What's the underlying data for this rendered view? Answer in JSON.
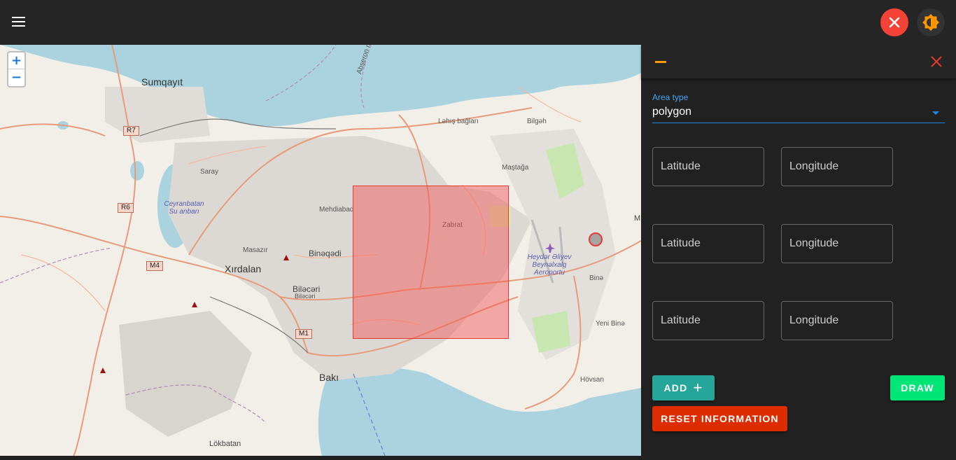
{
  "topbar": {
    "menu_icon": "hamburger-icon",
    "close_icon": "close-icon",
    "theme_icon": "brightness-icon"
  },
  "map": {
    "zoom_in": "+",
    "zoom_out": "−",
    "labels": {
      "sumqayit": "Sumqayıt",
      "abseron": "Abşeron rayonu",
      "lahic": "Ləhış bağları",
      "bilgah": "Bilgəh",
      "mastaga": "Maştağa",
      "saray": "Saray",
      "ceyranbatan": "Ceyranbatan Su anbarı",
      "mehdiabad": "Mehdiabad",
      "zabrat": "Zabrat",
      "masazir": "Masazır",
      "binaqadi": "Binəqədi",
      "xirdalan": "Xırdalan",
      "bilacari": "Biləcəri",
      "bilacari2": "Biləcəri",
      "airport": "Heydər Əliyev Beynəlxalq Aeroportu",
      "bina": "Binə",
      "yeni_bina": "Yeni Binə",
      "baki": "Bakı",
      "hovsan": "Hövsan",
      "lokbatan": "Lökbatan",
      "m_edge": "M"
    },
    "shields": {
      "r7": "R7",
      "r6": "R6",
      "m4": "M4",
      "m1": "M1"
    }
  },
  "panel": {
    "minimize_icon": "minimize-icon",
    "close_icon": "close-icon",
    "area_type_label": "Area type",
    "area_type_value": "polygon",
    "rows": [
      {
        "lat_placeholder": "Latitude",
        "lon_placeholder": "Longitude"
      },
      {
        "lat_placeholder": "Latitude",
        "lon_placeholder": "Longitude"
      },
      {
        "lat_placeholder": "Latitude",
        "lon_placeholder": "Longitude"
      }
    ],
    "add_label": "ADD",
    "add_icon": "plus-icon",
    "draw_label": "DRAW",
    "reset_label": "RESET INFORMATION"
  },
  "colors": {
    "topbar_bg": "#252525",
    "panel_bg": "#212121",
    "close_red": "#f44336",
    "theme_orange": "#ff9800",
    "accent_blue": "#1e88e5",
    "add_teal": "#26a69a",
    "draw_green": "#00e676",
    "reset_red": "#dd2c00",
    "polygon_fill": "#f45050"
  }
}
